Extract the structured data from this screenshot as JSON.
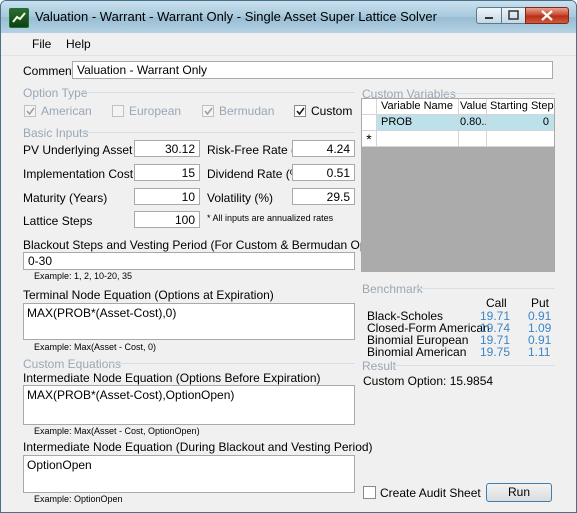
{
  "window": {
    "title": "Valuation - Warrant - Warrant Only - Single Asset Super Lattice Solver"
  },
  "menu": {
    "file": "File",
    "help": "Help"
  },
  "comment": {
    "label": "Comment",
    "value": "Valuation - Warrant Only"
  },
  "option_type": {
    "header": "Option Type",
    "american": {
      "label": "American",
      "checked": true,
      "enabled": false
    },
    "european": {
      "label": "European",
      "checked": false,
      "enabled": false
    },
    "bermudan": {
      "label": "Bermudan",
      "checked": true,
      "enabled": false
    },
    "custom": {
      "label": "Custom",
      "checked": true,
      "enabled": true
    }
  },
  "basic_inputs": {
    "header": "Basic Inputs",
    "pv_underlying": {
      "label": "PV Underlying Asset ($)",
      "value": "30.12"
    },
    "implementation_cost": {
      "label": "Implementation Cost ($)",
      "value": "15"
    },
    "maturity": {
      "label": "Maturity (Years)",
      "value": "10"
    },
    "lattice_steps": {
      "label": "Lattice Steps",
      "value": "100"
    },
    "risk_free": {
      "label": "Risk-Free Rate (%)",
      "value": "4.24"
    },
    "dividend": {
      "label": "Dividend Rate (%)",
      "value": "0.51"
    },
    "volatility": {
      "label": "Volatility (%)",
      "value": "29.5"
    },
    "note": "* All inputs are annualized rates"
  },
  "blackout": {
    "label": "Blackout Steps and Vesting Period (For Custom & Bermudan Option)",
    "value": "0-30",
    "example": "Example: 1, 2, 10-20, 35"
  },
  "terminal": {
    "label": "Terminal Node Equation (Options at Expiration)",
    "value": "MAX(PROB*(Asset-Cost),0)",
    "example": "Example: Max(Asset - Cost, 0)"
  },
  "custom_equations": {
    "header": "Custom Equations"
  },
  "intermediate": {
    "label": "Intermediate Node Equation (Options Before Expiration)",
    "value": "MAX(PROB*(Asset-Cost),OptionOpen)",
    "example": "Example: Max(Asset - Cost, OptionOpen)"
  },
  "intermediate_blackout": {
    "label": "Intermediate Node Equation (During Blackout and Vesting Period)",
    "value": "OptionOpen",
    "example": "Example: OptionOpen"
  },
  "custom_variables": {
    "header": "Custom Variables",
    "columns": [
      "Variable Name",
      "Value",
      "Starting Step"
    ],
    "rows": [
      {
        "name": "PROB",
        "value": "0.80...",
        "step": "0"
      }
    ],
    "new_row_marker": "*"
  },
  "benchmark": {
    "header": "Benchmark",
    "call_header": "Call",
    "put_header": "Put",
    "rows": [
      {
        "name": "Black-Scholes",
        "call": "19.71",
        "put": "0.91"
      },
      {
        "name": "Closed-Form American",
        "call": "19.74",
        "put": "1.09"
      },
      {
        "name": "Binomial European",
        "call": "19.71",
        "put": "0.91"
      },
      {
        "name": "Binomial American",
        "call": "19.75",
        "put": "1.11"
      }
    ]
  },
  "result": {
    "header": "Result",
    "text": "Custom Option: 15.9854"
  },
  "audit": {
    "label": "Create Audit Sheet",
    "checked": false
  },
  "run": {
    "label": "Run"
  },
  "colors": {
    "accent": "#3c86c8",
    "group_header": "#9aa7b5",
    "selected_row": "#bde1ea"
  }
}
